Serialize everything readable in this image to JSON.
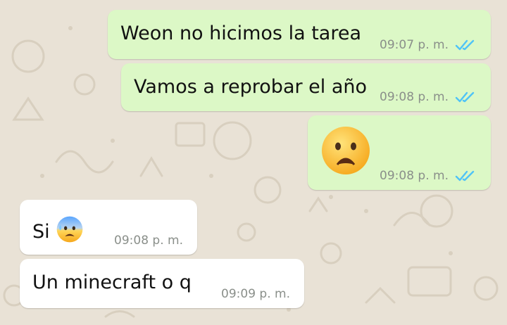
{
  "chat": {
    "messages": [
      {
        "direction": "outgoing",
        "text": "Weon no hicimos la tarea",
        "time": "09:07 p. m.",
        "status": "read",
        "status_icon": "double-check-icon"
      },
      {
        "direction": "outgoing",
        "text": "Vamos a reprobar el año",
        "time": "09:08 p. m.",
        "status": "read",
        "status_icon": "double-check-icon"
      },
      {
        "direction": "outgoing",
        "emoji": "frowning-open-mouth-face",
        "time": "09:08 p. m.",
        "status": "read",
        "status_icon": "double-check-icon"
      },
      {
        "direction": "incoming",
        "text": "Si",
        "emoji": "anxious-face-with-sweat",
        "time": "09:08 p. m."
      },
      {
        "direction": "incoming",
        "text": "Un minecraft o q",
        "time": "09:09 p. m."
      }
    ]
  },
  "colors": {
    "outgoing_bubble": "#dcf8c6",
    "incoming_bubble": "#ffffff",
    "read_ticks": "#4fc3f7",
    "timestamp": "#8a8f8a",
    "wallpaper": "#e9e2d6"
  }
}
